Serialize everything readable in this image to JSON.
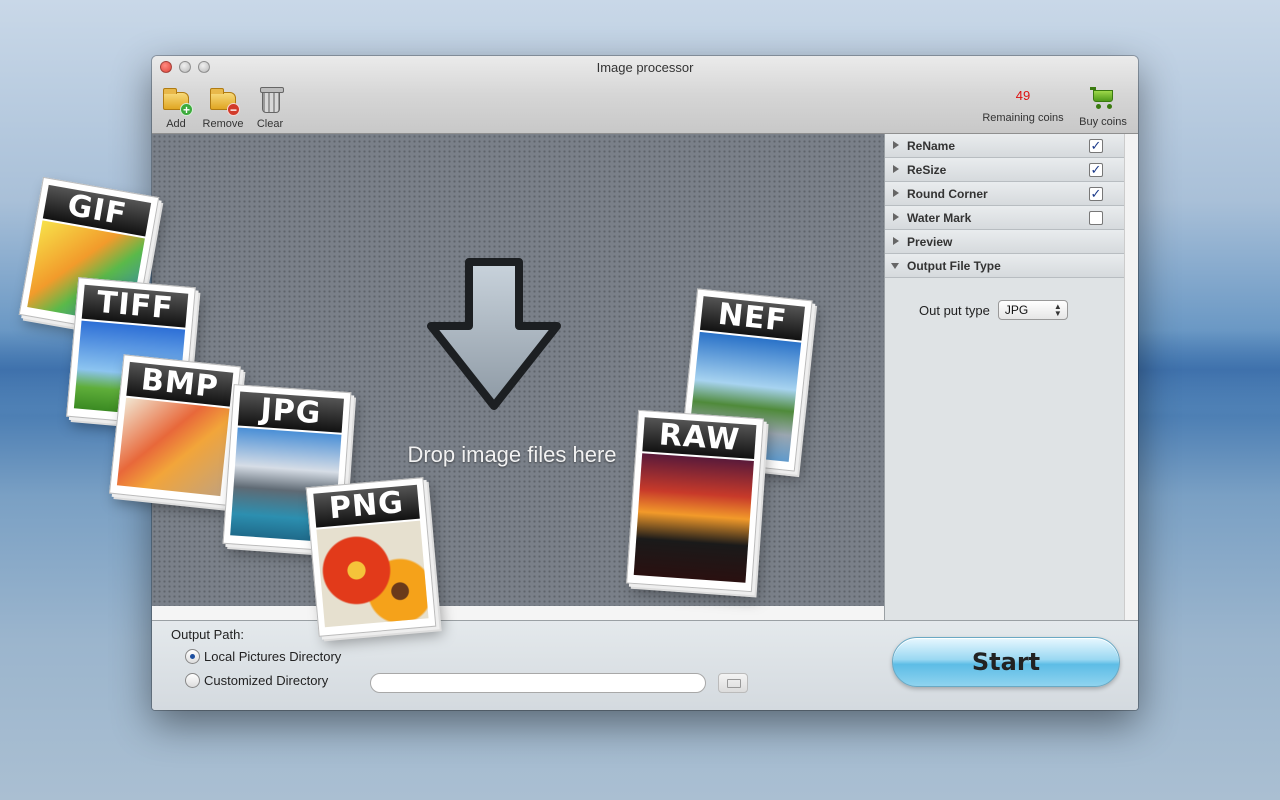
{
  "window": {
    "title": "Image processor"
  },
  "toolbar": {
    "add_label": "Add",
    "remove_label": "Remove",
    "clear_label": "Clear",
    "coins_count": "49",
    "coins_label": "Remaining coins",
    "buy_label": "Buy coins"
  },
  "dropzone": {
    "text": "Drop image files here"
  },
  "file_types": [
    "GIF",
    "TIFF",
    "BMP",
    "JPG",
    "PNG",
    "NEF",
    "RAW"
  ],
  "options": {
    "items": [
      {
        "label": "ReName",
        "checked": "✓"
      },
      {
        "label": "ReSize",
        "checked": "✓"
      },
      {
        "label": "Round Corner",
        "checked": "✓"
      },
      {
        "label": "Water Mark",
        "checked": ""
      },
      {
        "label": "Preview"
      },
      {
        "label": "Output File Type"
      }
    ],
    "output_type_label": "Out put type",
    "output_type_value": "JPG"
  },
  "output": {
    "title": "Output Path:",
    "local_label": "Local Pictures Directory",
    "custom_label": "Customized Directory",
    "path_value": ""
  },
  "start_label": "Start",
  "colors": {
    "accent": "#5dbde6",
    "coins": "#dd1111",
    "dropzone": "#7a8089"
  }
}
